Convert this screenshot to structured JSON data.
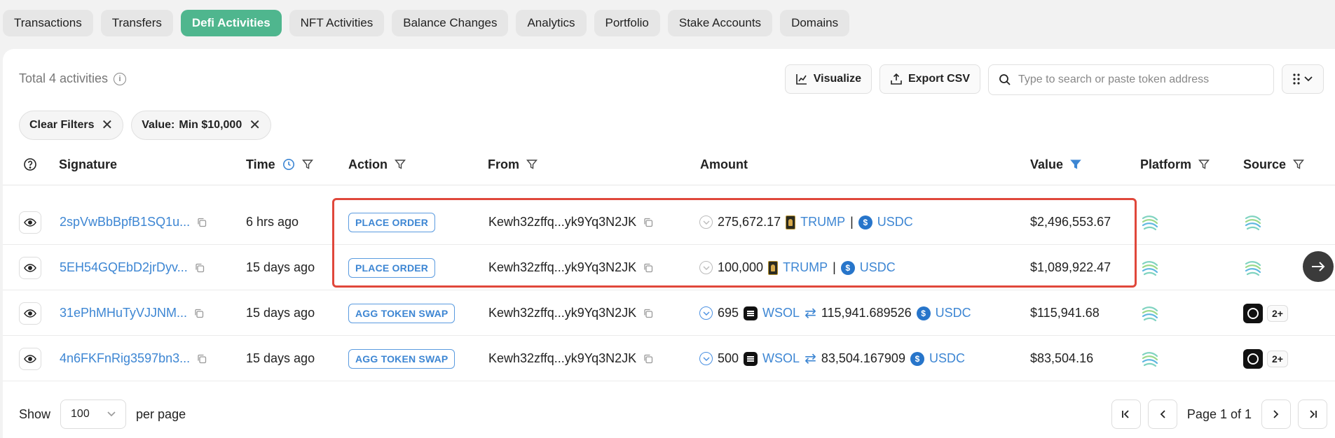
{
  "tabs": [
    {
      "label": "Transactions",
      "active": false
    },
    {
      "label": "Transfers",
      "active": false
    },
    {
      "label": "Defi Activities",
      "active": true
    },
    {
      "label": "NFT Activities",
      "active": false
    },
    {
      "label": "Balance Changes",
      "active": false
    },
    {
      "label": "Analytics",
      "active": false
    },
    {
      "label": "Portfolio",
      "active": false
    },
    {
      "label": "Stake Accounts",
      "active": false
    },
    {
      "label": "Domains",
      "active": false
    }
  ],
  "summary": {
    "total_label": "Total 4 activities"
  },
  "toolbar": {
    "visualize_label": "Visualize",
    "export_label": "Export CSV",
    "search_placeholder": "Type to search or paste token address"
  },
  "filters": {
    "clear_label": "Clear Filters",
    "value_filter_label": "Value:",
    "value_filter_value": "Min $10,000"
  },
  "table": {
    "headers": {
      "signature": "Signature",
      "time": "Time",
      "action": "Action",
      "from": "From",
      "amount": "Amount",
      "value": "Value",
      "platform": "Platform",
      "source": "Source"
    },
    "rows": [
      {
        "signature": "2spVwBbBpfB1SQ1u...",
        "time": "6 hrs ago",
        "action": "PLACE ORDER",
        "from": "Kewh32zffq...yk9Yq3N2JK",
        "amount": "275,672.17",
        "token1": "TRUMP",
        "separator": "|",
        "token2": "USDC",
        "value": "$2,496,553.67"
      },
      {
        "signature": "5EH54GQEbD2jrDyv...",
        "time": "15 days ago",
        "action": "PLACE ORDER",
        "from": "Kewh32zffq...yk9Yq3N2JK",
        "amount": "100,000",
        "token1": "TRUMP",
        "separator": "|",
        "token2": "USDC",
        "value": "$1,089,922.47"
      },
      {
        "signature": "31ePhMHuTyVJJNM...",
        "time": "15 days ago",
        "action": "AGG TOKEN SWAP",
        "from": "Kewh32zffq...yk9Yq3N2JK",
        "amount": "695",
        "token1": "WSOL",
        "amount2": "115,941.689526",
        "token2": "USDC",
        "value": "$115,941.68",
        "source_more": "2+"
      },
      {
        "signature": "4n6FKFnRig3597bn3...",
        "time": "15 days ago",
        "action": "AGG TOKEN SWAP",
        "from": "Kewh32zffq...yk9Yq3N2JK",
        "amount": "500",
        "token1": "WSOL",
        "amount2": "83,504.167909",
        "token2": "USDC",
        "value": "$83,504.16",
        "source_more": "2+"
      }
    ]
  },
  "footer": {
    "show_label": "Show",
    "per_page_value": "100",
    "per_page_label": "per page",
    "page_text": "Page 1 of 1"
  },
  "colors": {
    "accent": "#4fb68e",
    "link": "#3d86d3",
    "highlight": "#e0473b",
    "active_filter": "#3d86d3"
  }
}
